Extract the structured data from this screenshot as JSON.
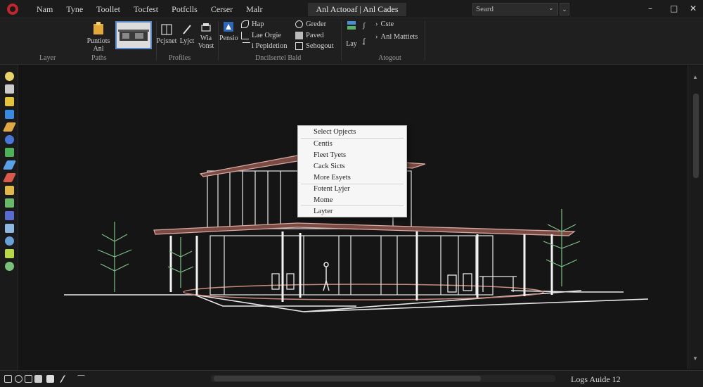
{
  "titlebar": {
    "menu": [
      "Nam",
      "Tyne",
      "Toollet",
      "Tocfest",
      "Potfclls",
      "Cerser",
      "Malr"
    ],
    "title": "Anl Actooaf | Anl Cades",
    "search_value": "Seard",
    "search_chevron": "⌄",
    "search_button_glyph": "⌄",
    "controls": {
      "minimize": "–",
      "restore": "□",
      "close": "✕"
    }
  },
  "ribbon": {
    "buttons": {
      "paste_line1": "Puntiots",
      "paste_line2": "Anl",
      "layers_label": "Pcjsnet",
      "layer_line": "Lyjct",
      "wiz_line1": "Wia",
      "wiz_line2": "Vonst",
      "pensil_label": "Pensio",
      "hap": "Hap",
      "line_grids": "Lae Orgie",
      "i_pepidetion": "i Pepidetion",
      "grader": "Greder",
      "paved": "Paved",
      "sehogout": "Sehogout",
      "lay": "Lay",
      "caste": "Cste",
      "anl_mattiets": "Anl Mattiets"
    },
    "groups": {
      "layer": "Layer",
      "paths": "Paths",
      "profiles": "Profiles",
      "dimensional": "Dncilsertel Bald",
      "atogout": "Atogout"
    }
  },
  "context_menu": {
    "items": [
      "Select Opjects",
      "Centis",
      "Fleet Tyets",
      "Cack Sicts",
      "More Esyets",
      "Fotent Lyjer",
      "Mome",
      "Layter"
    ]
  },
  "status": {
    "text": "Logs Auide 12"
  },
  "colors": {
    "accent_red": "#c0262d",
    "roof_edge": "#d9a9a0",
    "tree_green": "#7fc08a",
    "wire": "#e8e8e8"
  }
}
